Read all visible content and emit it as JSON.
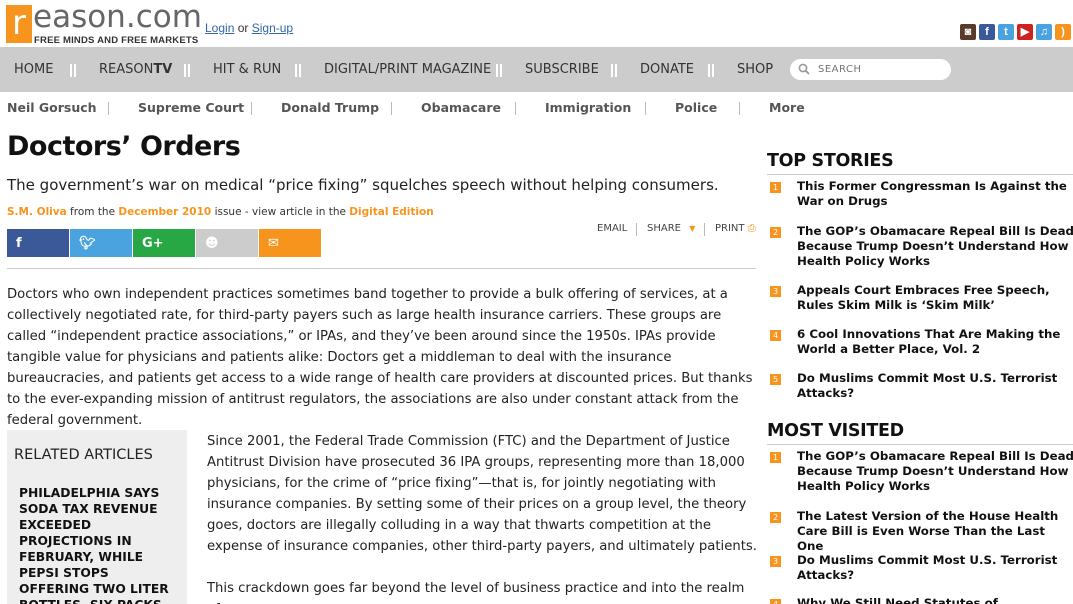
{
  "header": {
    "logo_letter": "r",
    "logo_word": "eason.com",
    "tagline": "FREE MINDS AND FREE MARKETS",
    "login": "Login",
    "or": "or",
    "signup": "Sign-up",
    "social_icons": [
      "instagram-icon",
      "facebook-icon",
      "twitter-icon",
      "youtube-icon",
      "itunes-icon",
      "rss-icon"
    ]
  },
  "nav": {
    "items": [
      "HOME",
      "REASON",
      "HIT & RUN",
      "DIGITAL/PRINT MAGAZINE",
      "SUBSCRIBE",
      "DONATE",
      "SHOP"
    ],
    "reason_tv_suffix": "TV",
    "search_placeholder": "SEARCH"
  },
  "topics": [
    "Neil Gorsuch",
    "Supreme Court",
    "Donald Trump",
    "Obamacare",
    "Immigration",
    "Police",
    "More"
  ],
  "article": {
    "title": "Doctors’ Orders",
    "dek": "The government’s war on medical “price fixing” squelches speech without helping consumers.",
    "author": "S.M. Oliva",
    "from": "from the",
    "issue": "December 2010",
    "issue_suffix": "issue - view article in the",
    "edition": "Digital Edition",
    "tools": {
      "email": "EMAIL",
      "share": "SHARE",
      "print": "PRINT"
    },
    "para1": "Doctors who own independent practices sometimes band together to provide a bulk offering of services, at a collectively negotiated rate, for third-party payers such as large health insurance carriers. These groups are called “independent practice associations,” or IPAs, and they’ve been around since the 1950s. IPAs provide tangible value for physicians and patients alike: Doctors get a middleman to deal with the insurance bureaucracies, and patients get access to a wide range of health care providers at discounted prices. But thanks to the ever-expanding mission of antitrust regulators, the associations are also under constant attack from the federal government.",
    "para2": "Since 2001, the Federal Trade Commission (FTC) and the Department of Justice Antitrust Division have prosecuted 36 IPA groups, representing more than 18,000 physicians, for the crime of “price fixing”—that is, for jointly negotiating with insurance companies. By setting some of their prices on a group level, the theory goes, doctors are illegally colluding in a way that thwarts competition at the expense of insurance companies, other third-party payers, and ultimately patients.",
    "para3": "This crackdown goes far beyond the level of business practice and into the realm of"
  },
  "related": {
    "heading": "RELATED ARTICLES",
    "item": "Philadelphia Says Soda Tax Revenue Exceeded Projections in February, While Pepsi Stops Offering Two Liter Bottles, Six-Packs"
  },
  "top_stories": {
    "heading": "TOP STORIES",
    "items": [
      "This Former Congressman Is Against the War on Drugs",
      "The GOP’s Obamacare Repeal Bill Is Dead Because Trump Doesn’t Understand How Health Policy Works",
      "Appeals Court Embraces Free Speech, Rules Skim Milk is ‘Skim Milk’",
      "6 Cool Innovations That Are Making the World a Better Place, Vol. 2",
      "Do Muslims Commit Most U.S. Terrorist Attacks?"
    ]
  },
  "most_visited": {
    "heading": "MOST VISITED",
    "items": [
      "The GOP’s Obamacare Repeal Bill Is Dead Because Trump Doesn’t Understand How Health Policy Works",
      "The Latest Version of the House Health Care Bill is Even Worse Than the Last One",
      "Do Muslims Commit Most U.S. Terrorist Attacks?",
      "Why We Still Need Statutes of Limitations for"
    ]
  },
  "numbers": [
    "1",
    "2",
    "3",
    "4",
    "5"
  ],
  "colors": {
    "accent": "#f7941d",
    "nav_bg": "#cccccc",
    "facebook": "#3b5998",
    "twitter": "#4aa3df",
    "google": "#28a745",
    "reddit": "#cccccc",
    "email": "#f7941d"
  }
}
